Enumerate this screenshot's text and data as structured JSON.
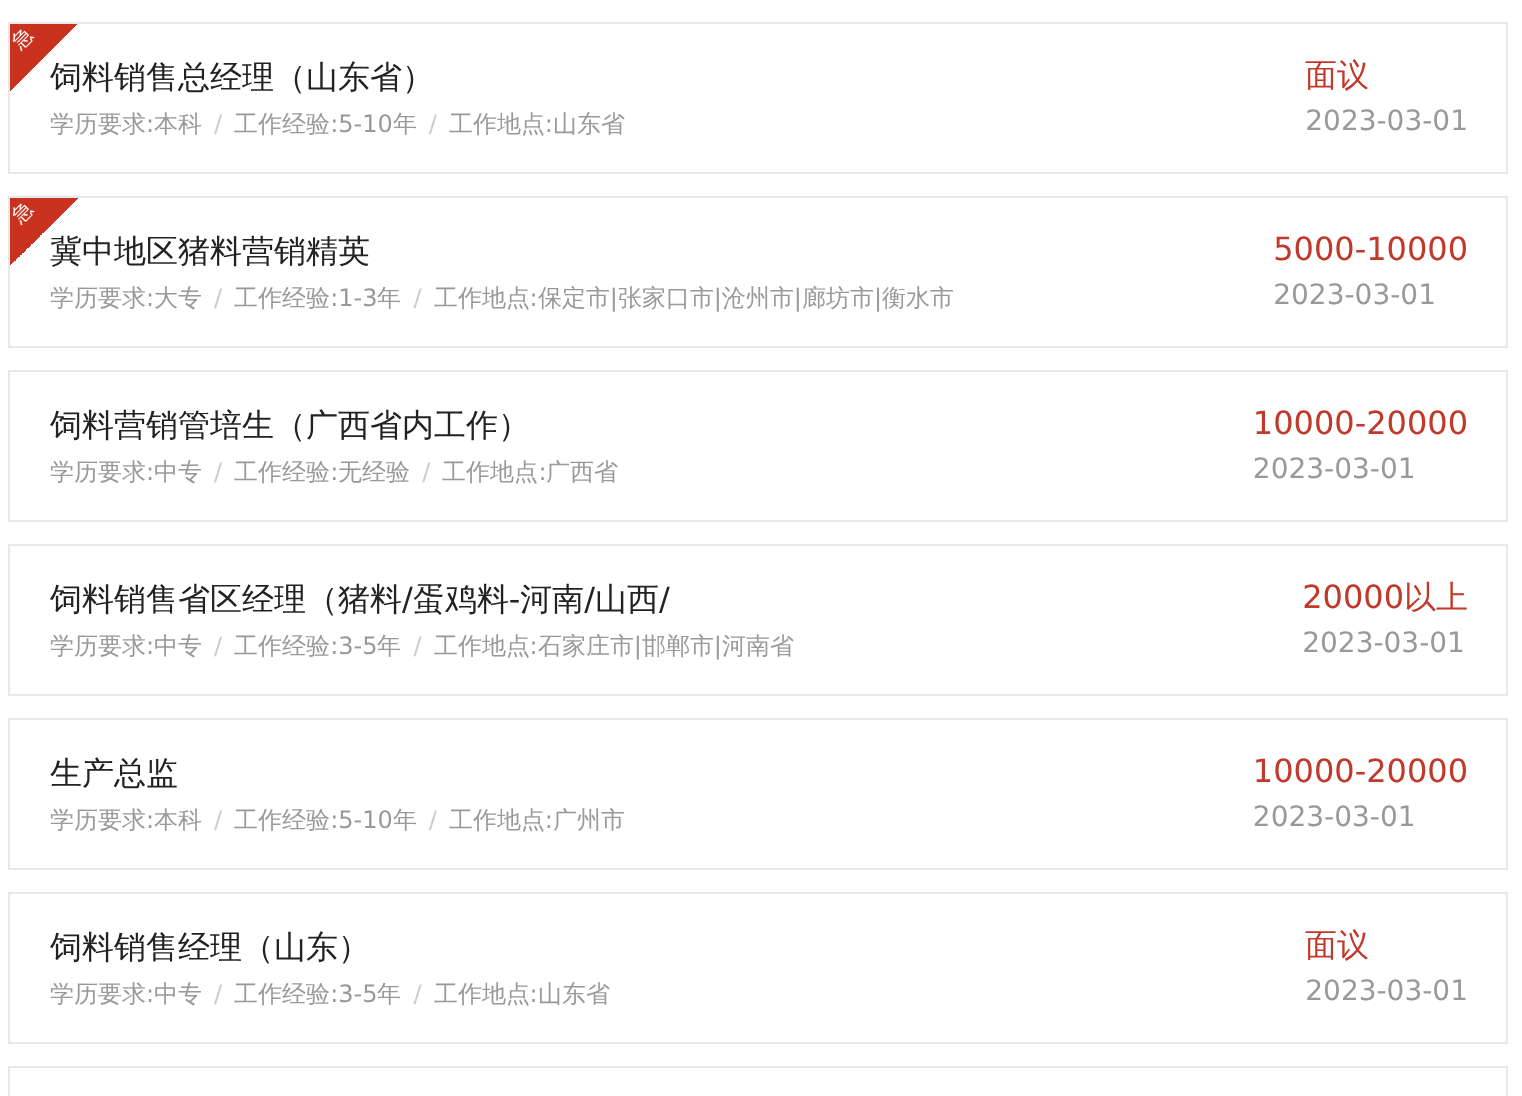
{
  "separator": "/",
  "jobs": [
    {
      "title": "饲料销售总经理（山东省）",
      "badge": "急",
      "meta": [
        "学历要求:本科",
        "工作经验:5-10年",
        "工作地点:山东省"
      ],
      "salary": "面议",
      "date": "2023-03-01"
    },
    {
      "title": "冀中地区猪料营销精英",
      "badge": "急",
      "meta": [
        "学历要求:大专",
        "工作经验:1-3年",
        "工作地点:保定市|张家口市|沧州市|廊坊市|衡水市"
      ],
      "salary": "5000-10000",
      "date": "2023-03-01"
    },
    {
      "title": "饲料营销管培生（广西省内工作）",
      "meta": [
        "学历要求:中专",
        "工作经验:无经验",
        "工作地点:广西省"
      ],
      "salary": "10000-20000",
      "date": "2023-03-01"
    },
    {
      "title": "饲料销售省区经理（猪料/蛋鸡料-河南/山西/",
      "meta": [
        "学历要求:中专",
        "工作经验:3-5年",
        "工作地点:石家庄市|邯郸市|河南省"
      ],
      "salary": "20000以上",
      "date": "2023-03-01"
    },
    {
      "title": "生产总监",
      "meta": [
        "学历要求:本科",
        "工作经验:5-10年",
        "工作地点:广州市"
      ],
      "salary": "10000-20000",
      "date": "2023-03-01"
    },
    {
      "title": "饲料销售经理（山东）",
      "meta": [
        "学历要求:中专",
        "工作经验:3-5年",
        "工作地点:山东省"
      ],
      "salary": "面议",
      "date": "2023-03-01"
    }
  ],
  "partial_card_below": true
}
